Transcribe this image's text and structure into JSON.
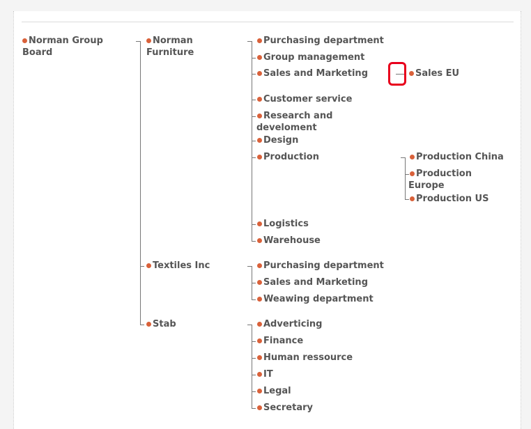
{
  "chart": {
    "root": {
      "line1": "Norman Group",
      "line2": "Board"
    },
    "level1": [
      {
        "line1": "Norman",
        "line2": "Furniture"
      },
      {
        "label": "Textiles Inc"
      },
      {
        "label": "Stab"
      }
    ],
    "norman_furniture": [
      {
        "label": "Purchasing department"
      },
      {
        "label": "Group management"
      },
      {
        "label": "Sales and Marketing"
      },
      {
        "label": "Customer service"
      },
      {
        "line1": "Research and",
        "line2": "develoment"
      },
      {
        "label": "Design"
      },
      {
        "label": "Production"
      },
      {
        "label": "Logistics"
      },
      {
        "label": "Warehouse"
      }
    ],
    "sales_and_marketing": [
      {
        "label": "Sales EU"
      }
    ],
    "production": [
      {
        "label": "Production China"
      },
      {
        "line1": "Production",
        "line2": "Europe"
      },
      {
        "label": "Production US"
      }
    ],
    "textiles_inc": [
      {
        "label": "Purchasing department"
      },
      {
        "label": "Sales and Marketing"
      },
      {
        "label": "Weawing department"
      }
    ],
    "stab": [
      {
        "label": "Adverticing"
      },
      {
        "label": "Finance"
      },
      {
        "label": "Human ressource"
      },
      {
        "label": "IT"
      },
      {
        "label": "Legal"
      },
      {
        "label": "Secretary"
      }
    ]
  },
  "colors": {
    "node_dot": "#d9613a",
    "text": "#555555",
    "connector": "#777777",
    "highlight": "#e8001c"
  }
}
